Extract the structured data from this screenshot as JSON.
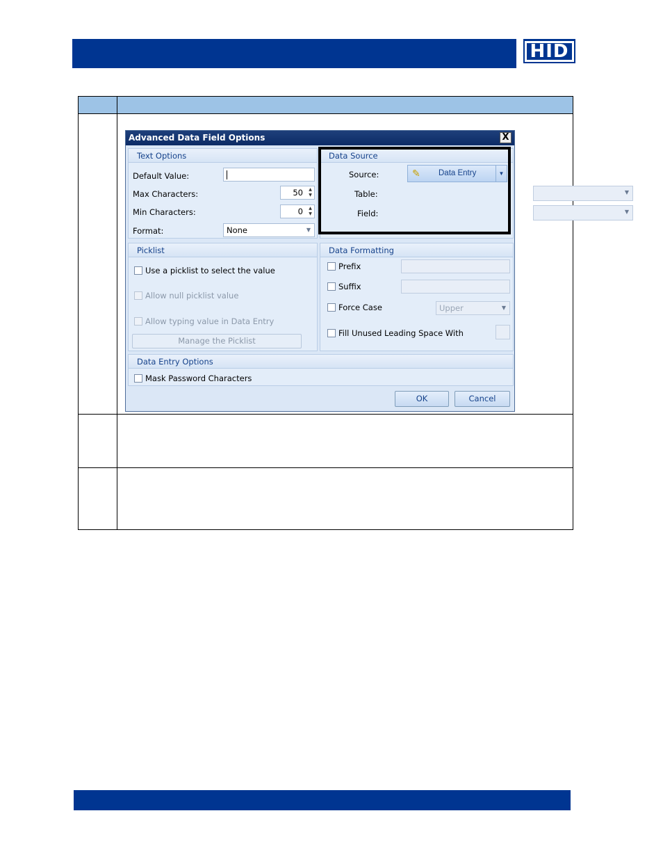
{
  "logo": {
    "text": "HID"
  },
  "dialog": {
    "title": "Advanced Data Field Options",
    "close_glyph": "X",
    "text_options": {
      "header": "Text Options",
      "default_value_label": "Default Value:",
      "default_value": "",
      "max_characters_label": "Max Characters:",
      "max_characters": "50",
      "min_characters_label": "Min Characters:",
      "min_characters": "0",
      "format_label": "Format:",
      "format_value": "None"
    },
    "data_source": {
      "header": "Data Source",
      "source_label": "Source:",
      "source_value": "Data Entry",
      "table_label": "Table:",
      "field_label": "Field:"
    },
    "picklist": {
      "header": "Picklist",
      "use_picklist": "Use a picklist to select the value",
      "allow_null": "Allow null picklist value",
      "allow_typing": "Allow typing value in Data Entry",
      "manage_button": "Manage the Picklist"
    },
    "data_formatting": {
      "header": "Data Formatting",
      "prefix": "Prefix",
      "suffix": "Suffix",
      "force_case": "Force Case",
      "force_case_value": "Upper",
      "fill_unused": "Fill Unused Leading Space With"
    },
    "data_entry_options": {
      "header": "Data Entry Options",
      "mask_password": "Mask Password Characters"
    },
    "ok_label": "OK",
    "cancel_label": "Cancel"
  },
  "colors": {
    "brand_blue": "#003591",
    "table_header": "#9dc3e6",
    "group_header_text": "#15428b"
  }
}
